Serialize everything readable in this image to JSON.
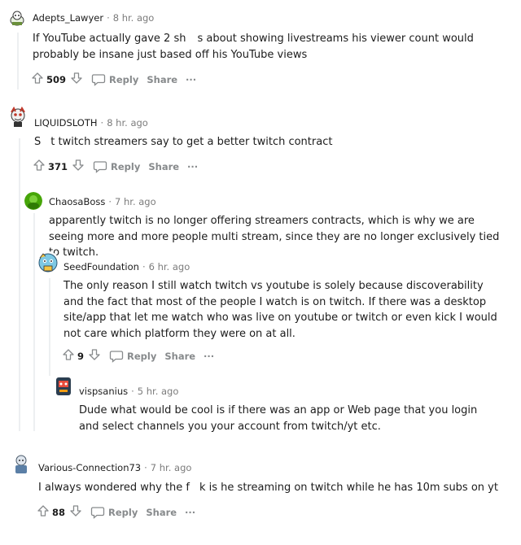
{
  "comments": [
    {
      "author": "Adepts_Lawyer",
      "time": "8 hr. ago",
      "text_before": "If YouTube actually gave 2 sh",
      "text_after": "s about showing livestreams his viewer count would probably be insane just based off his YouTube views",
      "votes": "509",
      "reply": "Reply",
      "share": "Share",
      "more": "···"
    },
    {
      "author": "LIQUIDSLOTH",
      "time": "8 hr. ago",
      "text_before": "S",
      "text_after": "t twitch streamers say to get a better twitch contract",
      "votes": "371",
      "reply": "Reply",
      "share": "Share",
      "more": "···"
    },
    {
      "author": "ChaosaBoss",
      "time": "7 hr. ago",
      "text": "apparently twitch is no longer offering streamers contracts, which is why we are seeing more and more people multi stream, since they are no longer exclusively tied to twitch."
    },
    {
      "author": "SeedFoundation",
      "time": "6 hr. ago",
      "text": "The only reason I still watch twitch vs youtube is solely because discoverability and the fact that most of the people I watch is on twitch. If there was a desktop site/app that let me watch who was live on youtube or twitch or even kick I would not care which platform they were on at all.",
      "votes": "9",
      "reply": "Reply",
      "share": "Share",
      "more": "···"
    },
    {
      "author": "vispsanius",
      "time": "5 hr. ago",
      "text": "Dude what would be cool is if there was an app or Web page that you login and select channels you your account from twitch/yt etc."
    },
    {
      "author": "Various-Connection73",
      "time": "7 hr. ago",
      "text_before": "I always wondered why the f",
      "text_after": "k is he streaming on twitch while he has 10m subs on yt",
      "votes": "88",
      "reply": "Reply",
      "share": "Share",
      "more": "···"
    }
  ],
  "colors": {
    "meta": "#7c7c7c",
    "action": "#878a8c",
    "text": "#1c1c1c",
    "thread_line": "#edeff1"
  }
}
